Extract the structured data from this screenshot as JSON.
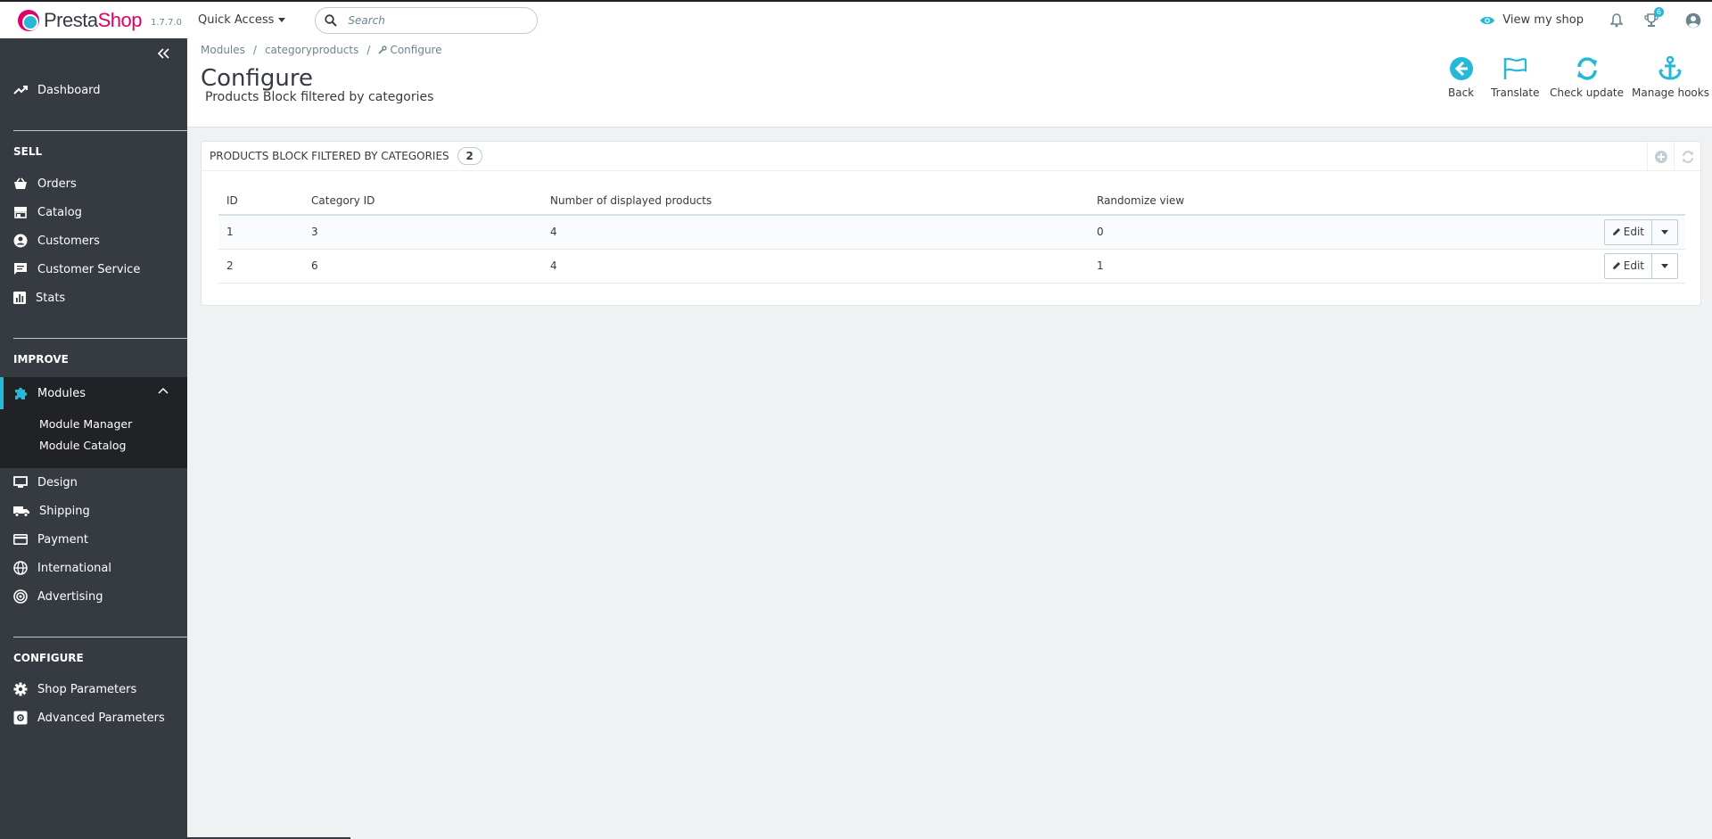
{
  "header": {
    "brand_part1": "Presta",
    "brand_part2": "Shop",
    "version": "1.7.7.0",
    "quick_access": "Quick Access",
    "search_placeholder": "Search",
    "view_my_shop": "View my shop",
    "orders_badge": "6"
  },
  "sidebar": {
    "dashboard": "Dashboard",
    "sections": {
      "sell": "SELL",
      "improve": "IMPROVE",
      "configure": "CONFIGURE"
    },
    "sell_items": [
      "Orders",
      "Catalog",
      "Customers",
      "Customer Service",
      "Stats"
    ],
    "modules": "Modules",
    "modules_sub": [
      "Module Manager",
      "Module Catalog"
    ],
    "improve_items": [
      "Design",
      "Shipping",
      "Payment",
      "International",
      "Advertising"
    ],
    "configure_items": [
      "Shop Parameters",
      "Advanced Parameters"
    ]
  },
  "breadcrumb": [
    "Modules",
    "categoryproducts",
    "Configure"
  ],
  "page": {
    "title": "Configure",
    "subtitle": "Products Block filtered by categories"
  },
  "toolbar": {
    "back": "Back",
    "translate": "Translate",
    "check_update": "Check update",
    "manage_hooks": "Manage hooks"
  },
  "panel": {
    "title": "Products Block filtered by categories",
    "count": "2",
    "columns": [
      "ID",
      "Category ID",
      "Number of displayed products",
      "Randomize view"
    ],
    "rows": [
      {
        "id": "1",
        "category_id": "3",
        "num_products": "4",
        "randomize": "0"
      },
      {
        "id": "2",
        "category_id": "6",
        "num_products": "4",
        "randomize": "1"
      }
    ],
    "edit_label": "Edit"
  },
  "colors": {
    "accent": "#25b9d7",
    "brand_pink": "#df0067",
    "sidebar_bg": "#363a41",
    "sidebar_active_bg": "#202226",
    "page_bg": "#eff1f2"
  }
}
